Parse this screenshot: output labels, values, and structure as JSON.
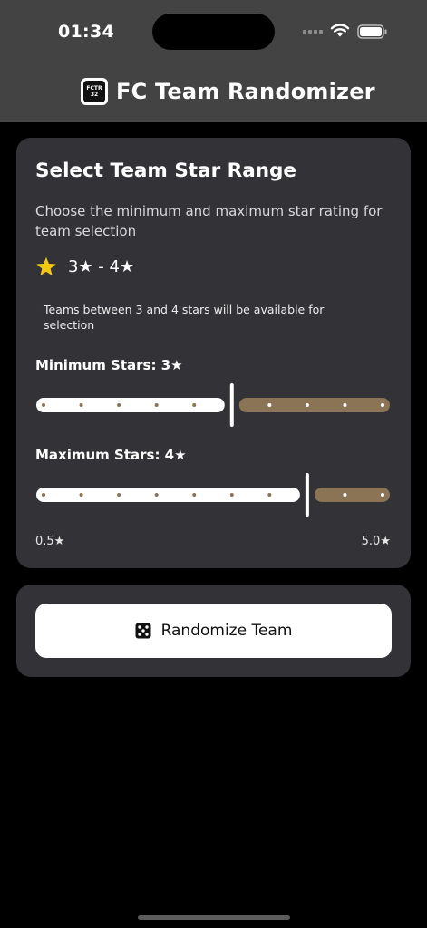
{
  "status_bar": {
    "time": "01:34"
  },
  "app": {
    "title": "FC Team Randomizer",
    "logo_text_top": "FCTR",
    "logo_text_bottom": "32"
  },
  "range_card": {
    "title": "Select Team Star Range",
    "description": "Choose the minimum and maximum star rating for team selection",
    "range_text": "3★ - 4★",
    "note": "Teams between 3 and 4 stars will be available for selection",
    "min_label": "Minimum Stars: 3★",
    "max_label": "Maximum Stars: 4★",
    "scale_min_label": "0.5★",
    "scale_max_label": "5.0★"
  },
  "sliders": {
    "min": 0.5,
    "max": 5.0,
    "step": 0.5,
    "min_value": 3.0,
    "max_value": 4.0
  },
  "action_card": {
    "button_label": "Randomize Team"
  },
  "colors": {
    "accent": "#8a7455",
    "active_track": "#ffffff",
    "card": "#333236",
    "header": "#434343",
    "star": "#f5c518"
  },
  "icons": {
    "range": "star-icon",
    "button": "dice-icon"
  }
}
